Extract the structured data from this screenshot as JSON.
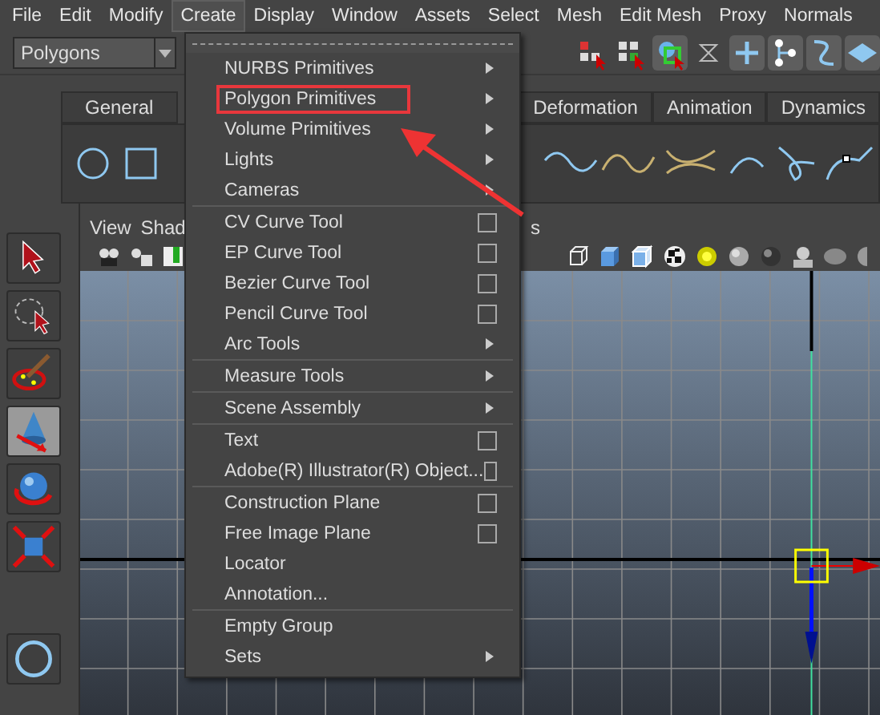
{
  "menubar": [
    {
      "label": "File",
      "selected": false
    },
    {
      "label": "Edit",
      "selected": false
    },
    {
      "label": "Modify",
      "selected": false
    },
    {
      "label": "Create",
      "selected": true
    },
    {
      "label": "Display",
      "selected": false
    },
    {
      "label": "Window",
      "selected": false
    },
    {
      "label": "Assets",
      "selected": false
    },
    {
      "label": "Select",
      "selected": false
    },
    {
      "label": "Mesh",
      "selected": false
    },
    {
      "label": "Edit Mesh",
      "selected": false
    },
    {
      "label": "Proxy",
      "selected": false
    },
    {
      "label": "Normals",
      "selected": false
    }
  ],
  "mode_dropdown": {
    "value": "Polygons"
  },
  "shelf_tabs": [
    {
      "label": "General",
      "selected": false
    },
    {
      "label": "Deformation",
      "selected": false
    },
    {
      "label": "Animation",
      "selected": false
    },
    {
      "label": "Dynamics",
      "selected": false
    }
  ],
  "tools": [
    {
      "kind": "select",
      "selected": false
    },
    {
      "kind": "lasso",
      "selected": false
    },
    {
      "kind": "paint",
      "selected": false
    },
    {
      "kind": "move",
      "selected": true
    },
    {
      "kind": "rotate",
      "selected": false
    },
    {
      "kind": "scale",
      "selected": false
    }
  ],
  "panel_menu": [
    "View",
    "Shad",
    "s"
  ],
  "create_menu": {
    "groups": [
      [
        {
          "label": "NURBS Primitives",
          "kind": "submenu",
          "boxed": false
        },
        {
          "label": "Polygon Primitives",
          "kind": "submenu",
          "boxed": true
        },
        {
          "label": "Volume Primitives",
          "kind": "submenu",
          "boxed": false
        },
        {
          "label": "Lights",
          "kind": "submenu",
          "boxed": false
        },
        {
          "label": "Cameras",
          "kind": "submenu",
          "boxed": false
        }
      ],
      [
        {
          "label": "CV Curve Tool",
          "kind": "option",
          "boxed": false
        },
        {
          "label": "EP Curve Tool",
          "kind": "option",
          "boxed": false
        },
        {
          "label": "Bezier Curve Tool",
          "kind": "option",
          "boxed": false
        },
        {
          "label": "Pencil Curve Tool",
          "kind": "option",
          "boxed": false
        },
        {
          "label": "Arc Tools",
          "kind": "submenu",
          "boxed": false
        }
      ],
      [
        {
          "label": "Measure Tools",
          "kind": "submenu",
          "boxed": false
        }
      ],
      [
        {
          "label": "Scene Assembly",
          "kind": "submenu",
          "boxed": false
        }
      ],
      [
        {
          "label": "Text",
          "kind": "option",
          "boxed": false
        },
        {
          "label": "Adobe(R) Illustrator(R) Object...",
          "kind": "option",
          "boxed": false
        }
      ],
      [
        {
          "label": "Construction Plane",
          "kind": "option",
          "boxed": false
        },
        {
          "label": "Free Image Plane",
          "kind": "option",
          "boxed": false
        },
        {
          "label": "Locator",
          "kind": "plain",
          "boxed": false
        },
        {
          "label": "Annotation...",
          "kind": "plain",
          "boxed": false
        }
      ],
      [
        {
          "label": "Empty Group",
          "kind": "plain",
          "boxed": false
        },
        {
          "label": "Sets",
          "kind": "submenu",
          "boxed": false
        }
      ]
    ]
  }
}
